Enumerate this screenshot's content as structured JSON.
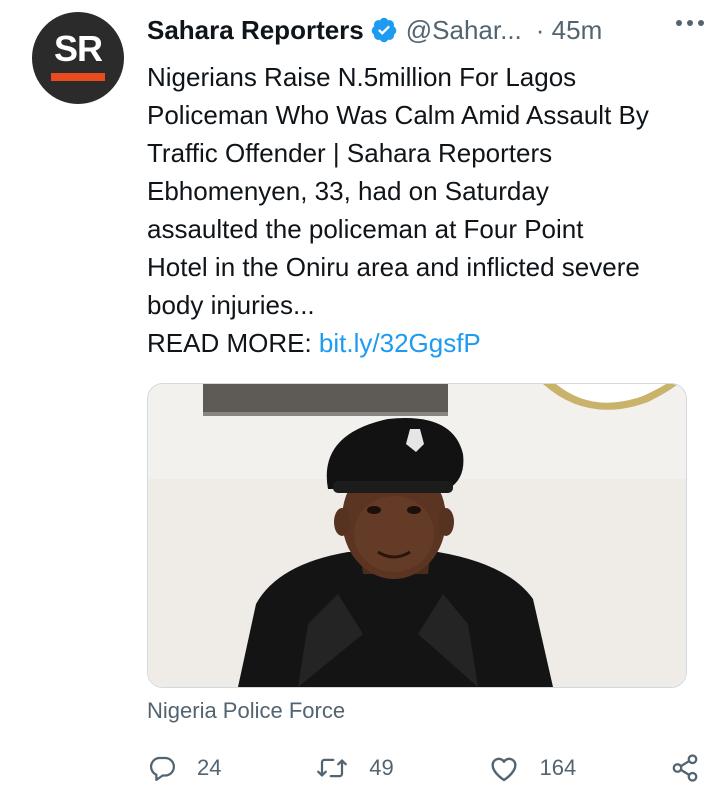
{
  "tweet": {
    "avatar_text": "SR",
    "author_name": "Sahara Reporters",
    "handle": "@Sahar...",
    "time": "· 45m",
    "text_lines": [
      "Nigerians Raise N.5million For Lagos",
      "Policeman Who Was Calm Amid Assault By",
      "Traffic Offender | Sahara Reporters",
      "Ebhomenyen, 33, had on Saturday",
      "assaulted the policeman at Four Point",
      "Hotel in the Oniru area and inflicted severe",
      "body injuries..."
    ],
    "read_more_label": "READ MORE:",
    "link_text": "bit.ly/32GgsfP",
    "card_source": "Nigeria Police Force"
  },
  "actions": {
    "reply_count": "24",
    "retweet_count": "49",
    "like_count": "164"
  },
  "icons": {
    "verified": "verified-badge-icon",
    "more": "more-dots-icon",
    "reply": "reply-icon",
    "retweet": "retweet-icon",
    "like": "heart-icon",
    "share": "share-icon"
  },
  "colors": {
    "link": "#1d9bf0",
    "secondary_text": "#536471",
    "avatar_bg": "#2b2b2b",
    "avatar_accent": "#e84c1e"
  }
}
